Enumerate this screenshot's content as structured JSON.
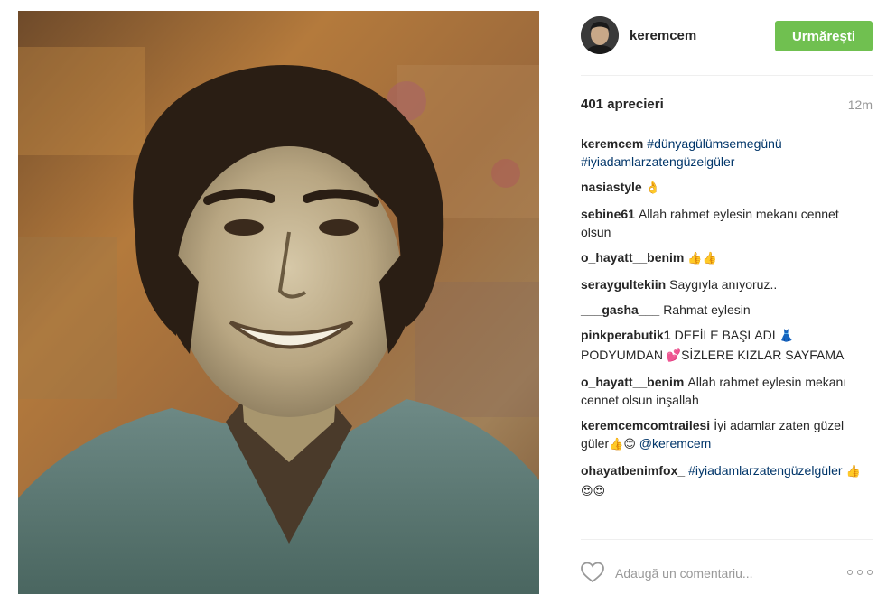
{
  "header": {
    "username": "keremcem",
    "follow_label": "Urmărești"
  },
  "stats": {
    "likes": "401 aprecieri",
    "time": "12m"
  },
  "comments": [
    {
      "user": "keremcem",
      "parts": [
        {
          "type": "tag",
          "text": "#dünyagülümsemegünü"
        },
        {
          "type": "text",
          "text": " "
        },
        {
          "type": "tag",
          "text": "#iyiadamlarzatengüzelgüler"
        }
      ]
    },
    {
      "user": "nasiastyle",
      "parts": [
        {
          "type": "emoji",
          "text": "👌"
        }
      ]
    },
    {
      "user": "sebine61",
      "parts": [
        {
          "type": "text",
          "text": "Allah rahmet eylesin mekanı cennet olsun"
        }
      ]
    },
    {
      "user": "o_hayatt__benim",
      "parts": [
        {
          "type": "emoji",
          "text": "👍👍"
        }
      ]
    },
    {
      "user": "seraygultekiin",
      "parts": [
        {
          "type": "text",
          "text": "Saygıyla anıyoruz.."
        }
      ]
    },
    {
      "user": "___gasha___",
      "parts": [
        {
          "type": "text",
          "text": "Rahmat eylesin"
        }
      ]
    },
    {
      "user": "pinkperabutik1",
      "parts": [
        {
          "type": "text",
          "text": "DEFİLE BAŞLADI "
        },
        {
          "type": "emoji",
          "text": "👗"
        },
        {
          "type": "text",
          "text": " PODYUMDAN "
        },
        {
          "type": "emoji",
          "text": "💕"
        },
        {
          "type": "text",
          "text": "SİZLERE KIZLAR SAYFAMA"
        }
      ]
    },
    {
      "user": "o_hayatt__benim",
      "parts": [
        {
          "type": "text",
          "text": "Allah rahmet eylesin mekanı cennet olsun inşallah"
        }
      ]
    },
    {
      "user": "keremcemcomtrailesi",
      "parts": [
        {
          "type": "text",
          "text": "İyi adamlar zaten güzel güler"
        },
        {
          "type": "emoji",
          "text": "👍😊"
        },
        {
          "type": "text",
          "text": " "
        },
        {
          "type": "tag",
          "text": "@keremcem"
        }
      ]
    },
    {
      "user": "ohayatbenimfox_",
      "parts": [
        {
          "type": "tag",
          "text": "#iyiadamlarzatengüzelgüler"
        },
        {
          "type": "text",
          "text": " "
        },
        {
          "type": "emoji",
          "text": "👍😍😍"
        }
      ]
    }
  ],
  "footer": {
    "comment_placeholder": "Adaugă un comentariu...",
    "icons": {
      "like": "heart-icon",
      "more": "more-options-icon"
    }
  },
  "colors": {
    "follow_button": "#70c050",
    "tag": "#003569",
    "muted": "#999999"
  }
}
